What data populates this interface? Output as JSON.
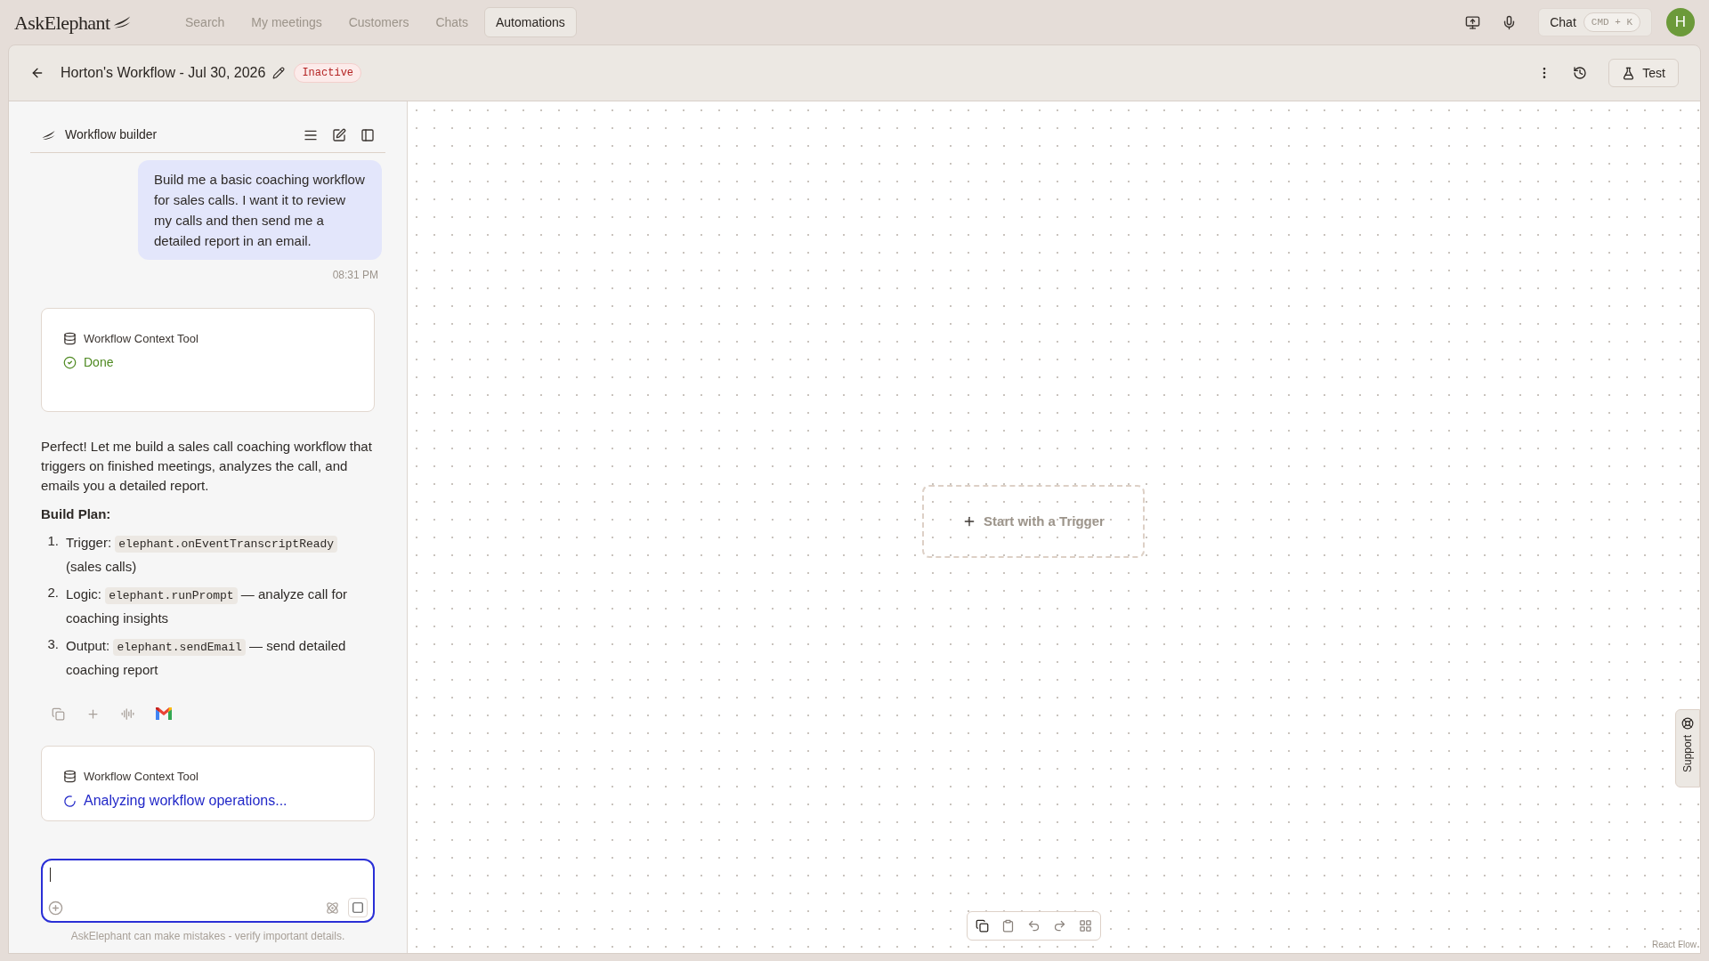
{
  "nav": {
    "logo": "AskElephant",
    "items": [
      {
        "label": "Search",
        "selected": false
      },
      {
        "label": "My meetings",
        "selected": false
      },
      {
        "label": "Customers",
        "selected": false
      },
      {
        "label": "Chats",
        "selected": false
      },
      {
        "label": "Automations",
        "selected": true
      }
    ],
    "chat_button": {
      "label": "Chat",
      "shortcut": "CMD + K"
    },
    "avatar": "H"
  },
  "workflow": {
    "title": "Horton's Workflow - Jul 30, 2026",
    "status": "Inactive",
    "test_button": "Test"
  },
  "chat": {
    "title": "Workflow builder",
    "messages": [
      {
        "kind": "user",
        "text": "Build me a basic coaching workflow for sales calls. I want it to review my calls and then send me a detailed report in an email.",
        "time": "08:31 PM"
      },
      {
        "kind": "tool",
        "name": "Workflow Context Tool",
        "done": true,
        "status_text": "Done"
      },
      {
        "kind": "assistant",
        "text": "Perfect! Let me build a sales call coaching workflow that triggers on finished meetings, analyzes the call, and emails you a detailed report.",
        "heading": "Build Plan:",
        "steps": [
          {
            "number": "1.",
            "label": "Trigger:",
            "code": "elephant.onEventTranscriptReady",
            "after": "(sales calls)"
          },
          {
            "number": "2.",
            "label": "Logic:",
            "code": "elephant.runPrompt",
            "after": "— analyze call for coaching insights"
          },
          {
            "number": "3.",
            "label": "Output:",
            "code": "elephant.sendEmail",
            "after": "— send detailed coaching report"
          }
        ]
      },
      {
        "kind": "tool",
        "name": "Workflow Context Tool",
        "done": false,
        "status_text": "Analyzing workflow operations..."
      }
    ],
    "disclaimer": "AskElephant can make mistakes - verify important details."
  },
  "canvas": {
    "trigger_placeholder": "Start with a Trigger",
    "attribution": "React Flow"
  },
  "support_tab": "Support"
}
